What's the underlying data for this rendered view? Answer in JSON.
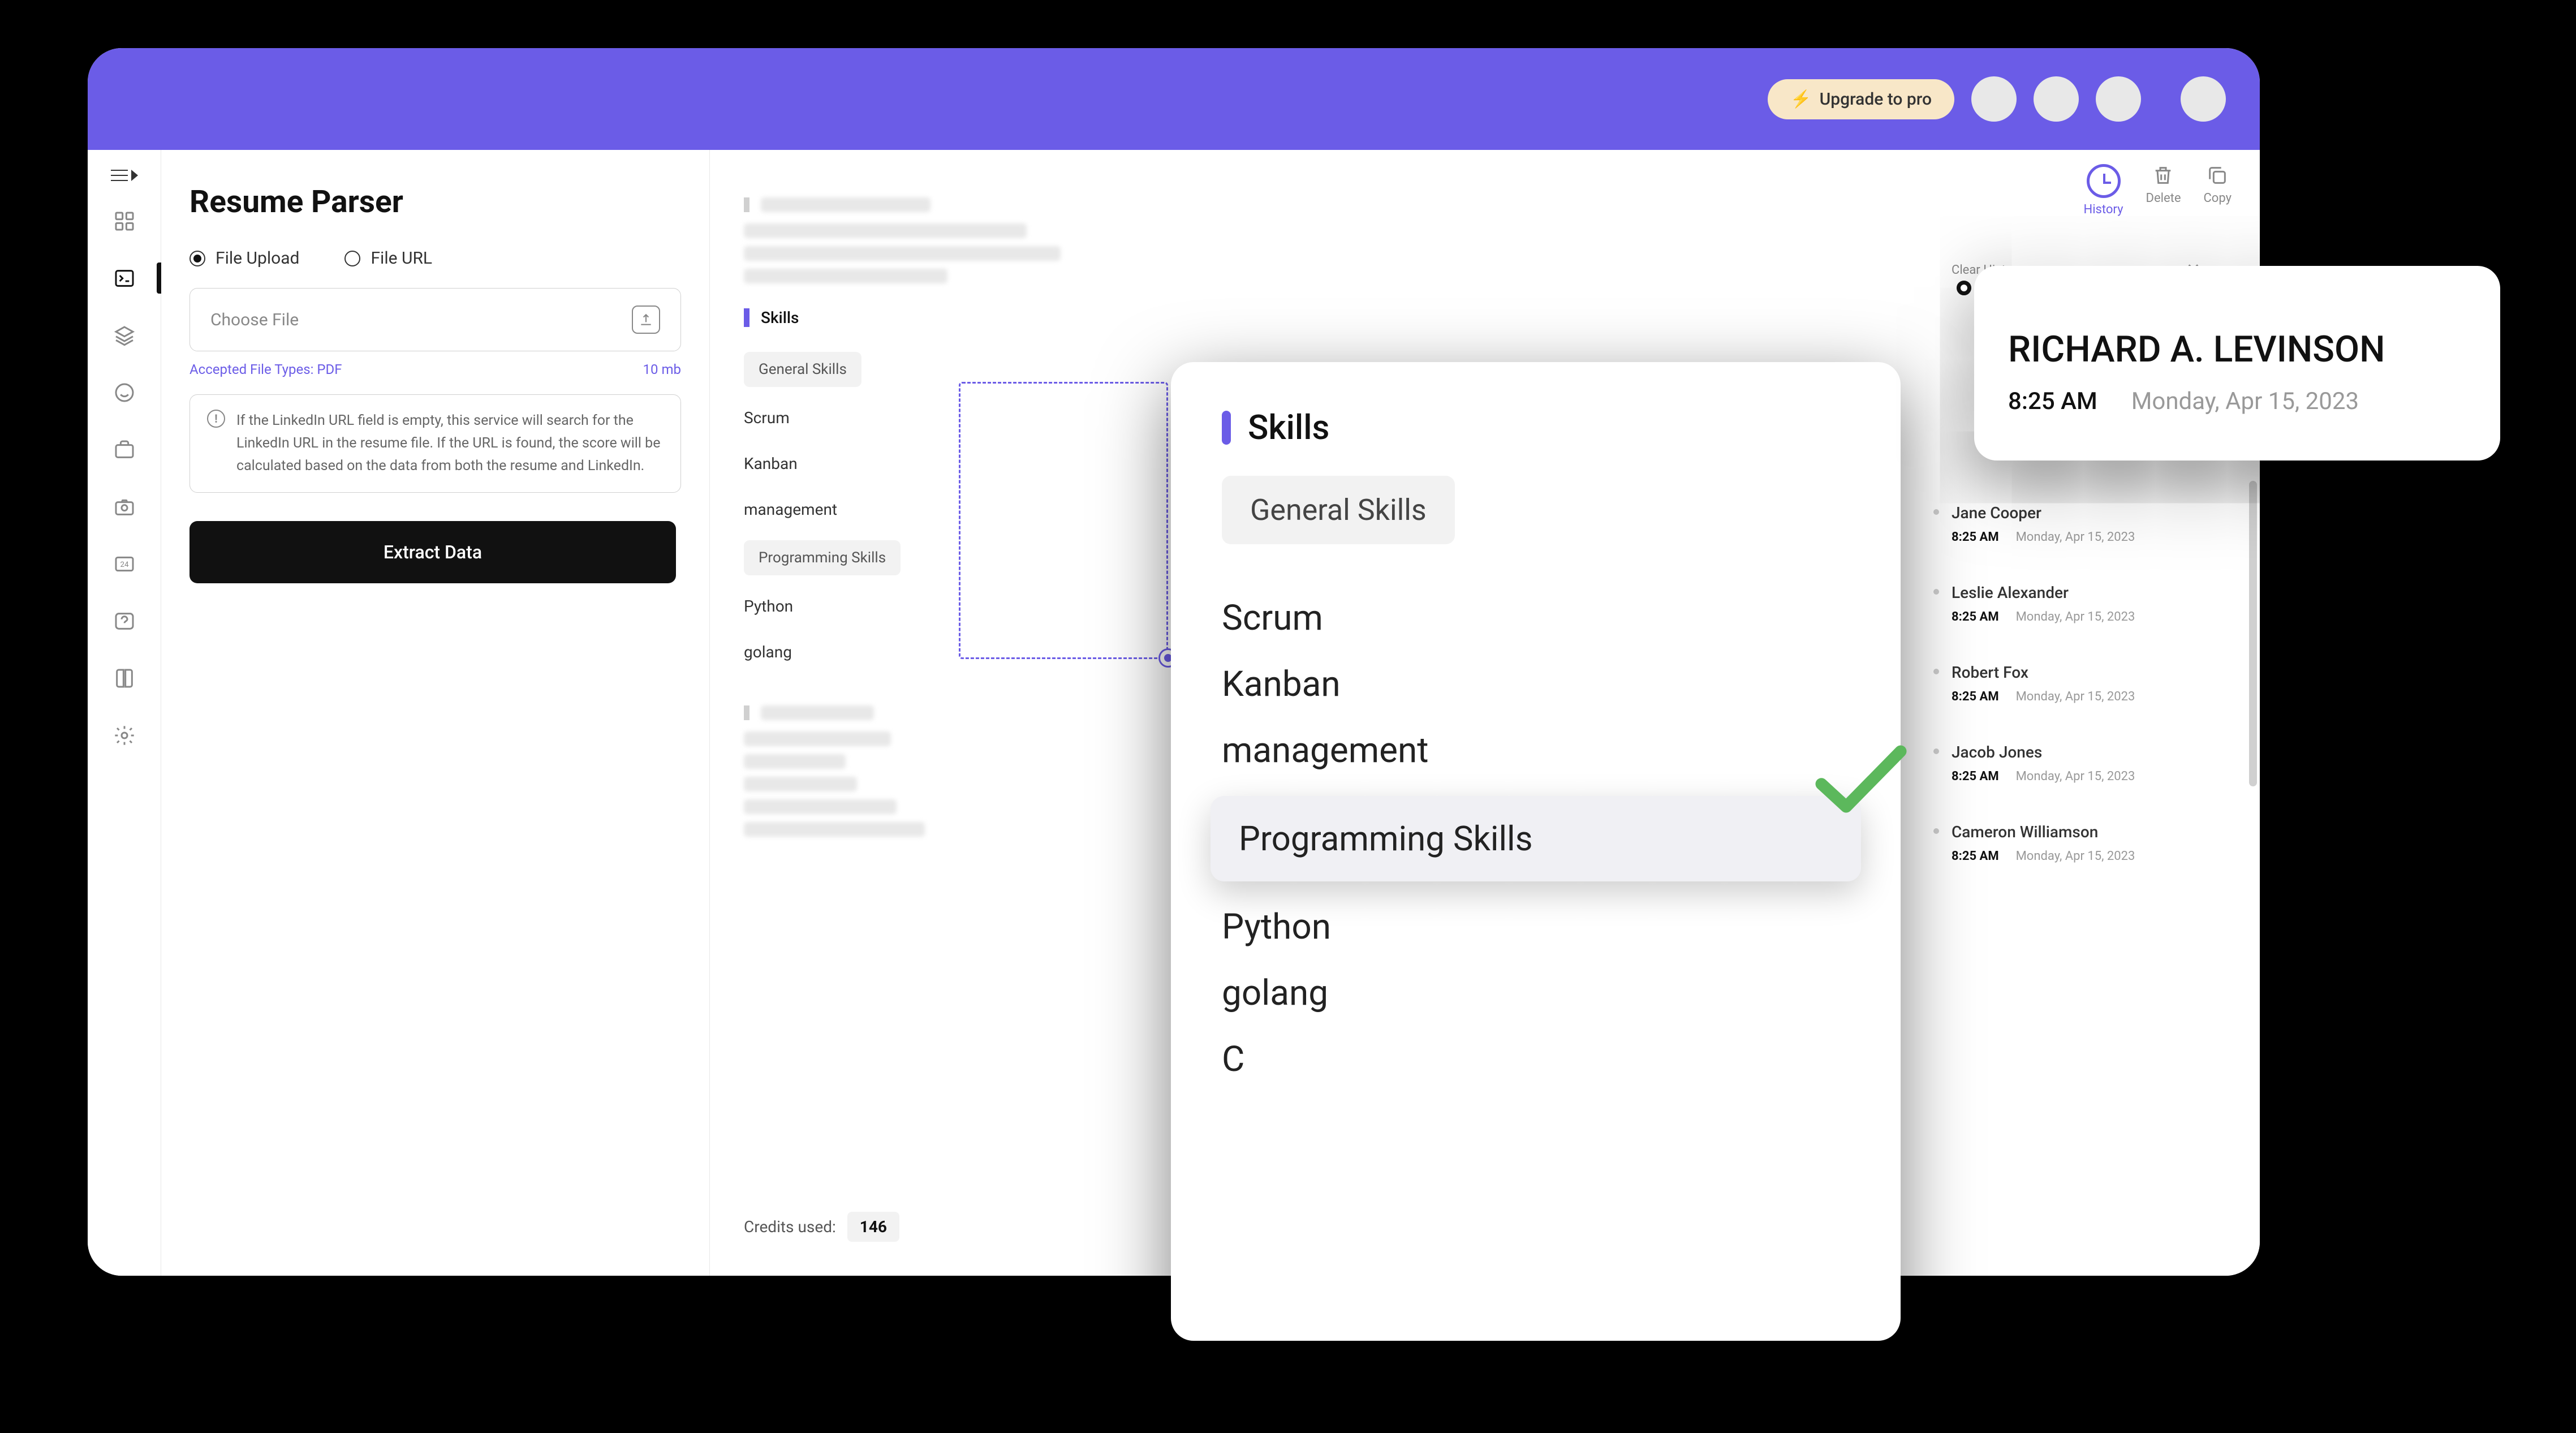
{
  "header": {
    "upgrade_label": "Upgrade to pro"
  },
  "page": {
    "title": "Resume Parser"
  },
  "upload": {
    "radio_file_upload": "File Upload",
    "radio_file_url": "File URL",
    "choose_file": "Choose File",
    "accepted_label": "Accepted File Types: PDF",
    "max_size": "10 mb",
    "info_text": "If the LinkedIn URL field is empty, this service will search for the LinkedIn URL in the resume file. If the URL is found, the score will be calculated based on the data from both the resume and LinkedIn.",
    "extract_button": "Extract Data"
  },
  "actions": {
    "history": "History",
    "delete": "Delete",
    "copy": "Copy"
  },
  "results": {
    "skills_heading": "Skills",
    "general_skills_tag": "General Skills",
    "skills_general": [
      "Scrum",
      "Kanban",
      "management"
    ],
    "programming_skills_tag": "Programming Skills",
    "skills_prog": [
      "Python",
      "golang"
    ],
    "credits_label": "Credits used:",
    "credits_value": "146"
  },
  "popup_skills": {
    "heading": "Skills",
    "general_tag": "General Skills",
    "items": [
      "Scrum",
      "Kanban",
      "management"
    ],
    "highlight": "Programming Skills",
    "items2": [
      "Python",
      "golang",
      "C"
    ]
  },
  "history_panel": {
    "clear_label": "Clear History",
    "items": [
      {
        "name": "Jane Cooper",
        "time": "8:25 AM",
        "date": "Monday, Apr 15, 2023"
      },
      {
        "name": "Leslie Alexander",
        "time": "8:25 AM",
        "date": "Monday, Apr 15, 2023"
      },
      {
        "name": "Robert Fox",
        "time": "8:25 AM",
        "date": "Monday, Apr 15, 2023"
      },
      {
        "name": "Jacob Jones",
        "time": "8:25 AM",
        "date": "Monday, Apr 15, 2023"
      },
      {
        "name": "Cameron Williamson",
        "time": "8:25 AM",
        "date": "Monday, Apr 15, 2023"
      }
    ]
  },
  "popup_history": {
    "name": "RICHARD A. LEVINSON",
    "time": "8:25 AM",
    "date": "Monday, Apr 15, 2023"
  }
}
